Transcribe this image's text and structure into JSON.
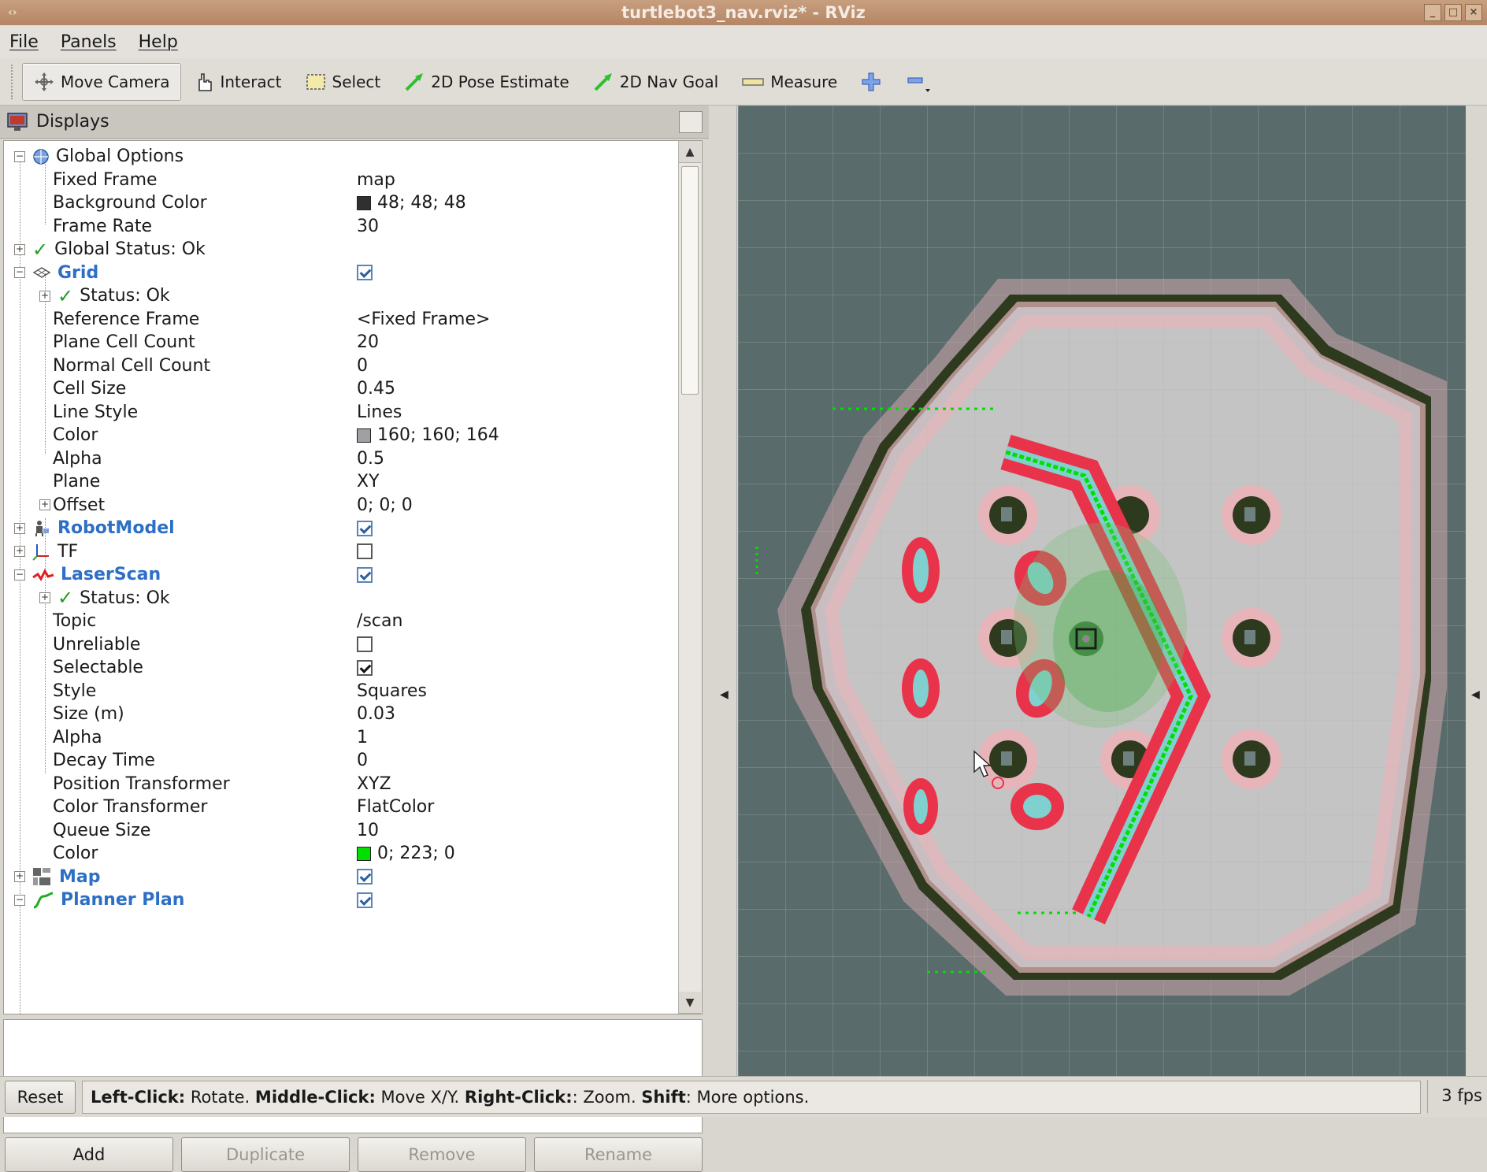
{
  "window": {
    "title": "turtlebot3_nav.rviz* - RViz",
    "wm_left": "‹›"
  },
  "menu": [
    "File",
    "Panels",
    "Help"
  ],
  "toolbar": {
    "tools": [
      {
        "label": "Move Camera",
        "icon": "move-camera-icon",
        "active": true
      },
      {
        "label": "Interact",
        "icon": "hand-icon"
      },
      {
        "label": "Select",
        "icon": "select-icon"
      },
      {
        "label": "2D Pose Estimate",
        "icon": "green-arrow-icon"
      },
      {
        "label": "2D Nav Goal",
        "icon": "green-arrow-icon"
      },
      {
        "label": "Measure",
        "icon": "ruler-icon"
      }
    ],
    "add_tool_icon": "plus-icon",
    "remove_tool_icon": "minus-icon"
  },
  "displays": {
    "title": "Displays",
    "rows": [
      {
        "name": "Global Options",
        "value": ""
      },
      {
        "name": "Fixed Frame",
        "value": "map"
      },
      {
        "name": "Background Color",
        "value": "48; 48; 48",
        "swatch": "#303030"
      },
      {
        "name": "Frame Rate",
        "value": "30"
      },
      {
        "name": "Global Status: Ok",
        "value": ""
      },
      {
        "name": "Grid",
        "value": ""
      },
      {
        "name": "Status: Ok",
        "value": ""
      },
      {
        "name": "Reference Frame",
        "value": "<Fixed Frame>"
      },
      {
        "name": "Plane Cell Count",
        "value": "20"
      },
      {
        "name": "Normal Cell Count",
        "value": "0"
      },
      {
        "name": "Cell Size",
        "value": "0.45"
      },
      {
        "name": "Line Style",
        "value": "Lines"
      },
      {
        "name": "Color",
        "value": "160; 160; 164",
        "swatch": "#a0a0a4"
      },
      {
        "name": "Alpha",
        "value": "0.5"
      },
      {
        "name": "Plane",
        "value": "XY"
      },
      {
        "name": "Offset",
        "value": "0; 0; 0"
      },
      {
        "name": "RobotModel",
        "value": ""
      },
      {
        "name": "TF",
        "value": ""
      },
      {
        "name": "LaserScan",
        "value": ""
      },
      {
        "name": "Status: Ok",
        "value": ""
      },
      {
        "name": "Topic",
        "value": "/scan"
      },
      {
        "name": "Unreliable",
        "value": ""
      },
      {
        "name": "Selectable",
        "value": ""
      },
      {
        "name": "Style",
        "value": "Squares"
      },
      {
        "name": "Size (m)",
        "value": "0.03"
      },
      {
        "name": "Alpha",
        "value": "1"
      },
      {
        "name": "Decay Time",
        "value": "0"
      },
      {
        "name": "Position Transformer",
        "value": "XYZ"
      },
      {
        "name": "Color Transformer",
        "value": "FlatColor"
      },
      {
        "name": "Queue Size",
        "value": "10"
      },
      {
        "name": "Color",
        "value": "0; 223; 0",
        "swatch": "#00df00"
      },
      {
        "name": "Map",
        "value": ""
      },
      {
        "name": "Planner Plan",
        "value": ""
      }
    ]
  },
  "buttons": {
    "add": "Add",
    "duplicate": "Duplicate",
    "remove": "Remove",
    "rename": "Rename"
  },
  "status": {
    "reset": "Reset",
    "k1": "Left-Click:",
    "v1": " Rotate. ",
    "k2": "Middle-Click:",
    "v2": " Move X/Y. ",
    "k3": "Right-Click:",
    "v3": ": Zoom. ",
    "k4": "Shift",
    "v4": ": More options.",
    "fps": "3 fps"
  },
  "colors": {
    "accent_blue": "#2d6fc6",
    "laser_green": "#00df00",
    "costmap_red": "#e8334a",
    "map_free": "#c4c4c4",
    "map_wall": "#2e3a1e",
    "background": "#5a6b6b"
  }
}
